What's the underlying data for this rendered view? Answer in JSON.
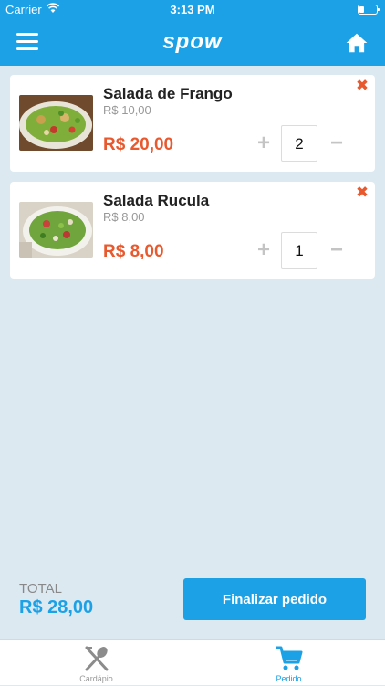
{
  "status_bar": {
    "carrier": "Carrier",
    "time": "3:13 PM"
  },
  "nav": {
    "title": "spow",
    "menu_icon": "hamburger-menu-icon",
    "home_icon": "home-icon"
  },
  "cart": {
    "items": [
      {
        "name": "Salada de Frango",
        "unit_price": "R$ 10,00",
        "total": "R$ 20,00",
        "quantity": "2"
      },
      {
        "name": "Salada Rucula",
        "unit_price": "R$ 8,00",
        "total": "R$ 8,00",
        "quantity": "1"
      }
    ],
    "plus_symbol": "+",
    "minus_symbol": "−",
    "remove_symbol": "✖"
  },
  "summary": {
    "total_label": "TOTAL",
    "total_value": "R$ 28,00",
    "checkout_label": "Finalizar pedido"
  },
  "tabs": [
    {
      "label": "Cardápio",
      "icon": "fork-spoon-icon",
      "active": false
    },
    {
      "label": "Pedido",
      "icon": "cart-icon",
      "active": true
    }
  ],
  "colors": {
    "primary": "#1da1e6",
    "accent": "#e8592e",
    "background": "#dde9f1"
  }
}
